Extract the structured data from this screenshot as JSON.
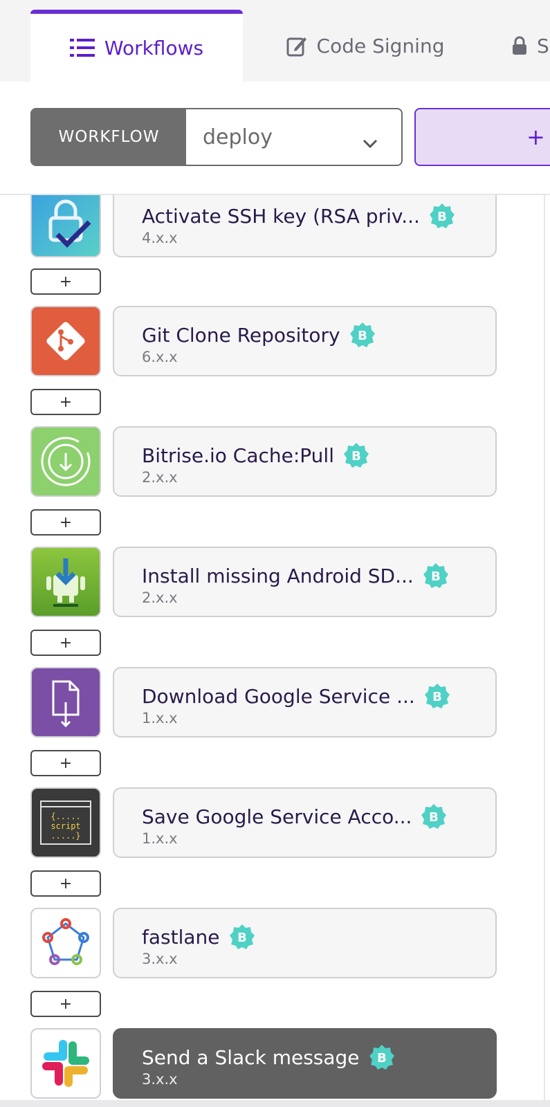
{
  "tabs": [
    {
      "label": "Workflows",
      "icon": "list-icon",
      "active": true
    },
    {
      "label": "Code Signing",
      "icon": "edit-icon",
      "active": false
    },
    {
      "label": "S",
      "icon": "lock-icon",
      "active": false
    }
  ],
  "toolbar": {
    "workflow_label": "WORKFLOW",
    "workflow_value": "deploy",
    "add_label": "+"
  },
  "steps": [
    {
      "name": "Activate SSH key (RSA priv...",
      "version": "4.x.x",
      "badge": "B",
      "icon": "ssh-key-icon"
    },
    {
      "name": "Git Clone Repository",
      "version": "6.x.x",
      "badge": "B",
      "icon": "git-icon"
    },
    {
      "name": "Bitrise.io Cache:Pull",
      "version": "2.x.x",
      "badge": "B",
      "icon": "cache-pull-icon"
    },
    {
      "name": "Install missing Android SD...",
      "version": "2.x.x",
      "badge": "B",
      "icon": "android-sdk-icon"
    },
    {
      "name": "Download Google Service ...",
      "version": "1.x.x",
      "badge": "B",
      "icon": "file-download-icon"
    },
    {
      "name": "Save Google Service Acco...",
      "version": "1.x.x",
      "badge": "B",
      "icon": "script-icon",
      "icon_text": [
        "{.....",
        "script",
        ".....}"
      ]
    },
    {
      "name": "fastlane",
      "version": "3.x.x",
      "badge": "B",
      "icon": "fastlane-icon"
    },
    {
      "name": "Send a Slack message",
      "version": "3.x.x",
      "badge": "B",
      "icon": "slack-icon",
      "selected": true
    }
  ],
  "add_step_label": "+",
  "colors": {
    "accent": "#6a2fd4",
    "badge": "#4fd1c5",
    "selected_card": "#616161"
  }
}
